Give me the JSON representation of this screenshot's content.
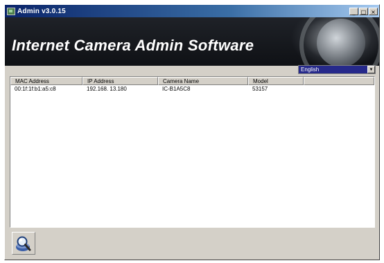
{
  "window": {
    "title": "Admin v3.0.15",
    "minimize_glyph": "_",
    "restore_glyph": "□",
    "close_glyph": "×"
  },
  "banner": {
    "title": "Internet Camera Admin Software"
  },
  "language": {
    "selected": "English",
    "dropdown_glyph": "▼"
  },
  "camera_list": {
    "columns": [
      "MAC Address",
      "IP Address",
      "Camera Name",
      "Model"
    ],
    "rows": [
      {
        "mac": "00:1f:1f:b1:a5:c8",
        "ip": "192.168. 13.180",
        "name": "IC-B1A5C8",
        "model": "53157"
      }
    ]
  },
  "icons": {
    "app": "camera-app-icon",
    "search": "search-cameras-icon"
  },
  "colors": {
    "titlebar": "#0a246a",
    "banner": "#1a1d22",
    "dialog_face": "#d4d0c8",
    "selection": "#26298a"
  }
}
